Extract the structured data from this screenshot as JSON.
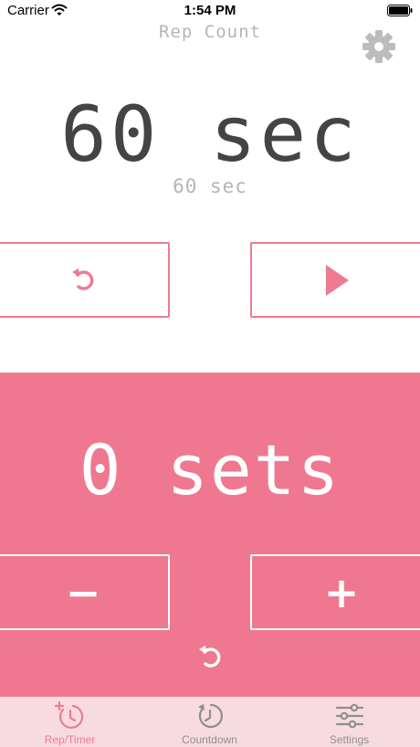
{
  "status_bar": {
    "carrier": "Carrier",
    "time": "1:54 PM",
    "wifi_icon": "wifi-icon",
    "battery_icon": "battery-icon"
  },
  "header": {
    "title": "Rep Count",
    "settings_icon": "gear-icon"
  },
  "timer": {
    "display": "60 sec",
    "subtitle": "60 sec",
    "reset_icon": "reset-icon",
    "play_icon": "play-icon"
  },
  "sets": {
    "display": "0 sets",
    "minus_label": "−",
    "plus_label": "+",
    "reset_icon": "reset-icon"
  },
  "tabs": [
    {
      "label": "Rep/Timer",
      "icon": "rep-timer-icon",
      "active": true
    },
    {
      "label": "Countdown",
      "icon": "countdown-icon",
      "active": false
    },
    {
      "label": "Settings",
      "icon": "sliders-icon",
      "active": false
    }
  ],
  "colors": {
    "accent": "#ee7a91",
    "panel": "#ef7890",
    "tab_bar": "#f8dbe1",
    "timer_text": "#444444",
    "muted_text": "#b5b5b5"
  }
}
